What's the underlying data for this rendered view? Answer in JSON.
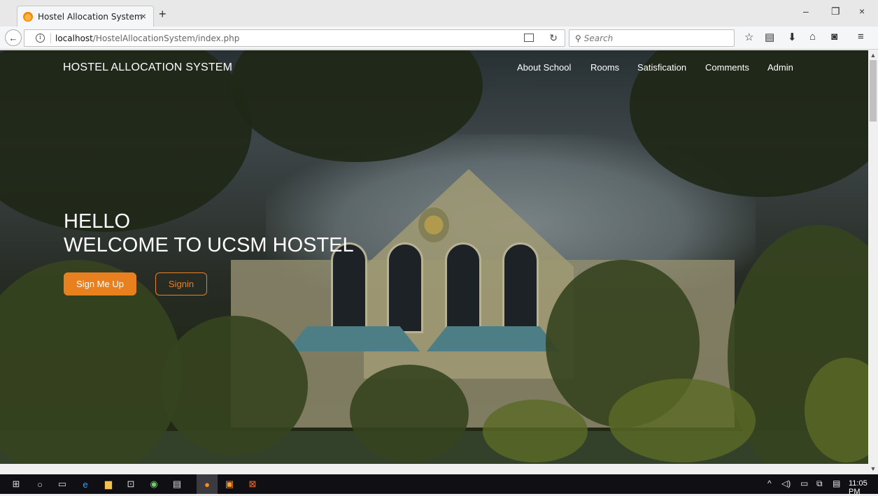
{
  "browser": {
    "tab_title": "Hostel Allocation System",
    "tab_close": "×",
    "new_tab": "+",
    "url_host": "localhost",
    "url_path": "/HostelAllocationSystem/index.php",
    "search_placeholder": "Search",
    "window_controls": {
      "minimize": "–",
      "restore": "❐",
      "close": "×"
    }
  },
  "site": {
    "brand": "HOSTEL ALLOCATION SYSTEM",
    "menu": [
      {
        "label": "About School"
      },
      {
        "label": "Rooms"
      },
      {
        "label": "Satisfication"
      },
      {
        "label": "Comments"
      },
      {
        "label": "Admin"
      }
    ],
    "hero": {
      "line1": "HELLO",
      "line2": "WELCOME TO UCSM HOSTEL",
      "signup_label": "Sign Me Up",
      "signin_label": "Signin"
    },
    "accent_color": "#e8801f"
  },
  "taskbar": {
    "clock": "11:05 PM"
  }
}
